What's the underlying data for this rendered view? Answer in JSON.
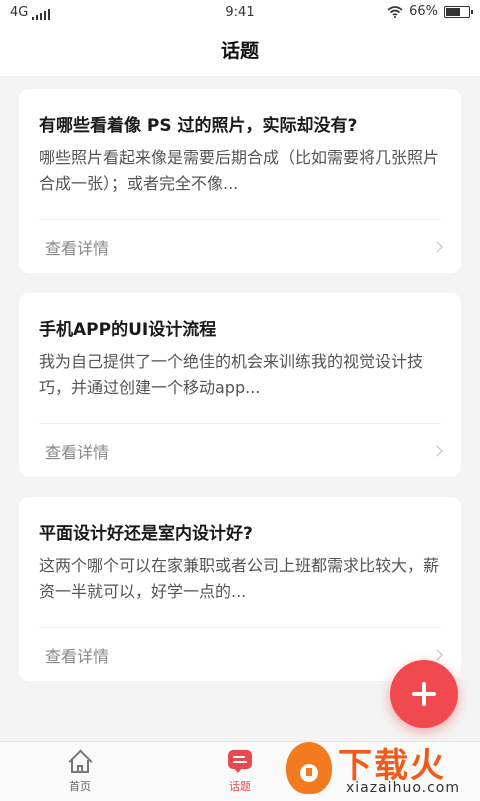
{
  "status_bar": {
    "network": "4G",
    "time": "9:41",
    "battery_percent": "66%",
    "battery_level": 0.66
  },
  "header": {
    "title": "话题"
  },
  "topics": [
    {
      "title": "有哪些看着像 PS 过的照片，实际却没有?",
      "summary": "哪些照片看起来像是需要后期合成（比如需要将几张照片合成一张）；或者完全不像...",
      "link": "查看详情"
    },
    {
      "title": "手机APP的UI设计流程",
      "summary": "我为自己提供了一个绝佳的机会来训练我的视觉设计技巧，并通过创建一个移动app...",
      "link": "查看详情"
    },
    {
      "title": "平面设计好还是室内设计好?",
      "summary": "这两个哪个可以在家兼职或者公司上班都需求比较大，薪资一半就可以，好学一点的...",
      "link": "查看详情"
    }
  ],
  "tab_bar": {
    "tabs": [
      {
        "label": "首页",
        "icon": "home-icon",
        "active": false
      },
      {
        "label": "话题",
        "icon": "chat-icon",
        "active": true
      }
    ]
  },
  "colors": {
    "accent": "#f04a4f",
    "background": "#f4f4f4"
  },
  "watermark": {
    "brand": "下载火",
    "domain": "xiazaihuo.com"
  }
}
